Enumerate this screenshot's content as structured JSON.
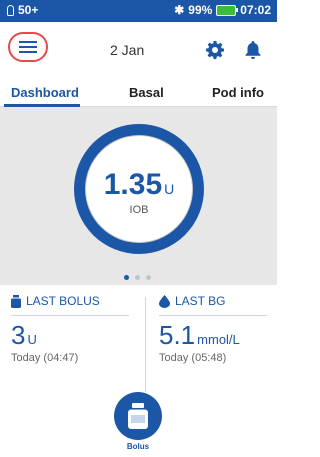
{
  "status_bar": {
    "pod_level": "50+",
    "battery": "99%",
    "time": "07:02",
    "bt_icon": "bluetooth-icon"
  },
  "header": {
    "date": "2 Jan",
    "menu_icon": "menu-icon",
    "settings_icon": "gear-icon",
    "notification_icon": "bell-icon"
  },
  "tabs": [
    {
      "label": "Dashboard",
      "active": true
    },
    {
      "label": "Basal",
      "active": false
    },
    {
      "label": "Pod info",
      "active": false
    }
  ],
  "iob": {
    "value": "1.35",
    "unit": "U",
    "label": "IOB"
  },
  "pager": {
    "pages": 3,
    "active": 1
  },
  "last_bolus": {
    "title": "LAST BOLUS",
    "value": "3",
    "unit": "U",
    "time": "Today (04:47)"
  },
  "last_bg": {
    "title": "LAST BG",
    "value": "5.1",
    "unit": "mmol/L",
    "time": "Today (05:48)"
  },
  "bolus_button": {
    "label": "Bolus"
  },
  "colors": {
    "primary": "#1b56a7",
    "highlight": "#e64b4b",
    "battery": "#3bbf3a"
  }
}
